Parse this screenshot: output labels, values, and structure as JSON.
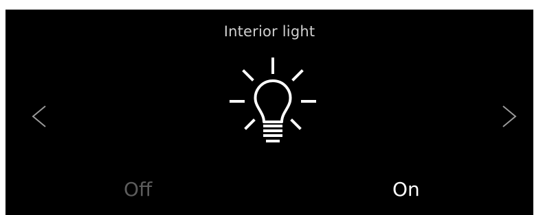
{
  "screen": {
    "title": "Interior light",
    "icon": "lightbulb-icon"
  },
  "navigation": {
    "prev_icon": "chevron-left-icon",
    "next_icon": "chevron-right-icon"
  },
  "options": {
    "off_label": "Off",
    "on_label": "On",
    "selected": "On"
  },
  "colors": {
    "background": "#000000",
    "selected_text": "#ffffff",
    "unselected_text": "#5c5c5c",
    "title_text": "#cfcfcf"
  }
}
